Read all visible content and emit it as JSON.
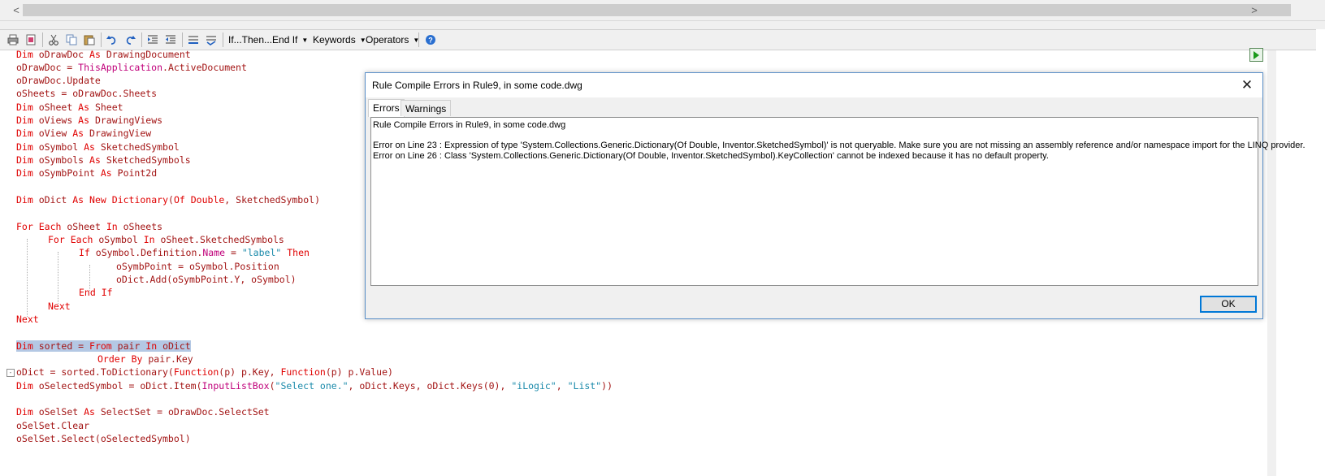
{
  "scrollbar": {
    "left_arrow": "<",
    "right_arrow": ">"
  },
  "toolbar": {
    "if_then_label": "If...Then...End If",
    "keywords_label": "Keywords",
    "operators_label": "Operators",
    "buttons": [
      "print-icon",
      "print-preview-icon",
      "cut-icon",
      "copy-icon",
      "paste-icon",
      "undo-icon",
      "redo-icon",
      "indent-icon",
      "outdent-icon",
      "comment-icon",
      "uncomment-icon",
      "help-icon"
    ]
  },
  "code": {
    "line1": [
      "Dim",
      " oDrawDoc ",
      "As",
      " DrawingDocument"
    ],
    "line2": [
      "oDrawDoc = ",
      "ThisApplication",
      ".ActiveDocument"
    ],
    "line3": [
      "oDrawDoc.Update"
    ],
    "line4": [
      "oSheets = oDrawDoc.Sheets"
    ],
    "line5": [
      "Dim",
      " oSheet ",
      "As",
      " Sheet"
    ],
    "line6": [
      "Dim",
      " oViews ",
      "As",
      " DrawingViews"
    ],
    "line7": [
      "Dim",
      " oView ",
      "As",
      " DrawingView"
    ],
    "line8": [
      "Dim",
      " oSymbol ",
      "As",
      " SketchedSymbol"
    ],
    "line9": [
      "Dim",
      " oSymbols ",
      "As",
      " SketchedSymbols"
    ],
    "line10": [
      "Dim",
      " oSymbPoint ",
      "As",
      " Point2d"
    ],
    "line12": [
      "Dim",
      " oDict ",
      "As",
      " ",
      "New",
      " ",
      "Dictionary",
      "(",
      "Of",
      " ",
      "Double",
      ", SketchedSymbol)"
    ],
    "line14": [
      "For",
      " ",
      "Each",
      " oSheet ",
      "In",
      " oSheets"
    ],
    "line15": [
      "For",
      " ",
      "Each",
      " oSymbol ",
      "In",
      " oSheet.SketchedSymbols"
    ],
    "line16": [
      "If",
      " oSymbol.Definition.",
      "Name",
      " = ",
      "\"label\"",
      " ",
      "Then"
    ],
    "line17": [
      "oSymbPoint = oSymbol.Position"
    ],
    "line18": [
      "oDict.Add(oSymbPoint.Y, oSymbol)"
    ],
    "line19": [
      "End",
      " ",
      "If"
    ],
    "line20": [
      "Next"
    ],
    "line21": [
      "Next"
    ],
    "line23": [
      "Dim",
      " sorted = ",
      "From",
      " pair ",
      "In",
      " oDict"
    ],
    "line24": [
      "Order",
      " ",
      "By",
      " pair.Key"
    ],
    "line25": [
      "oDict = sorted.ToDictionary(",
      "Function",
      "(p) p.Key, ",
      "Function",
      "(p) p.Value)"
    ],
    "line26": [
      "Dim",
      " oSelectedSymbol = oDict.Item(",
      "InputListBox",
      "(",
      "\"Select one.\"",
      ", oDict.Keys, oDict.Keys(0), ",
      "\"iLogic\"",
      ", ",
      "\"List\"",
      "))"
    ],
    "line28": [
      "Dim",
      " oSelSet ",
      "As",
      " SelectSet = oDrawDoc.SelectSet"
    ],
    "line29": [
      "oSelSet.Clear"
    ],
    "line30": [
      "oSelSet.Select(oSelectedSymbol)"
    ]
  },
  "dialog": {
    "title": "Rule Compile Errors in Rule9, in some code.dwg",
    "close_glyph": "✕",
    "tabs": [
      "Errors",
      "Warnings"
    ],
    "body_title": "Rule Compile Errors in Rule9, in some code.dwg",
    "errors": [
      "Error on Line 23 : Expression of type 'System.Collections.Generic.Dictionary(Of Double, Inventor.SketchedSymbol)' is not queryable. Make sure you are not missing an assembly reference and/or namespace import for the LINQ provider.",
      "Error on Line 26 : Class 'System.Collections.Generic.Dictionary(Of Double, Inventor.SketchedSymbol).KeyCollection' cannot be indexed because it has no default property."
    ],
    "ok_label": "OK"
  },
  "fold_glyph": "-"
}
